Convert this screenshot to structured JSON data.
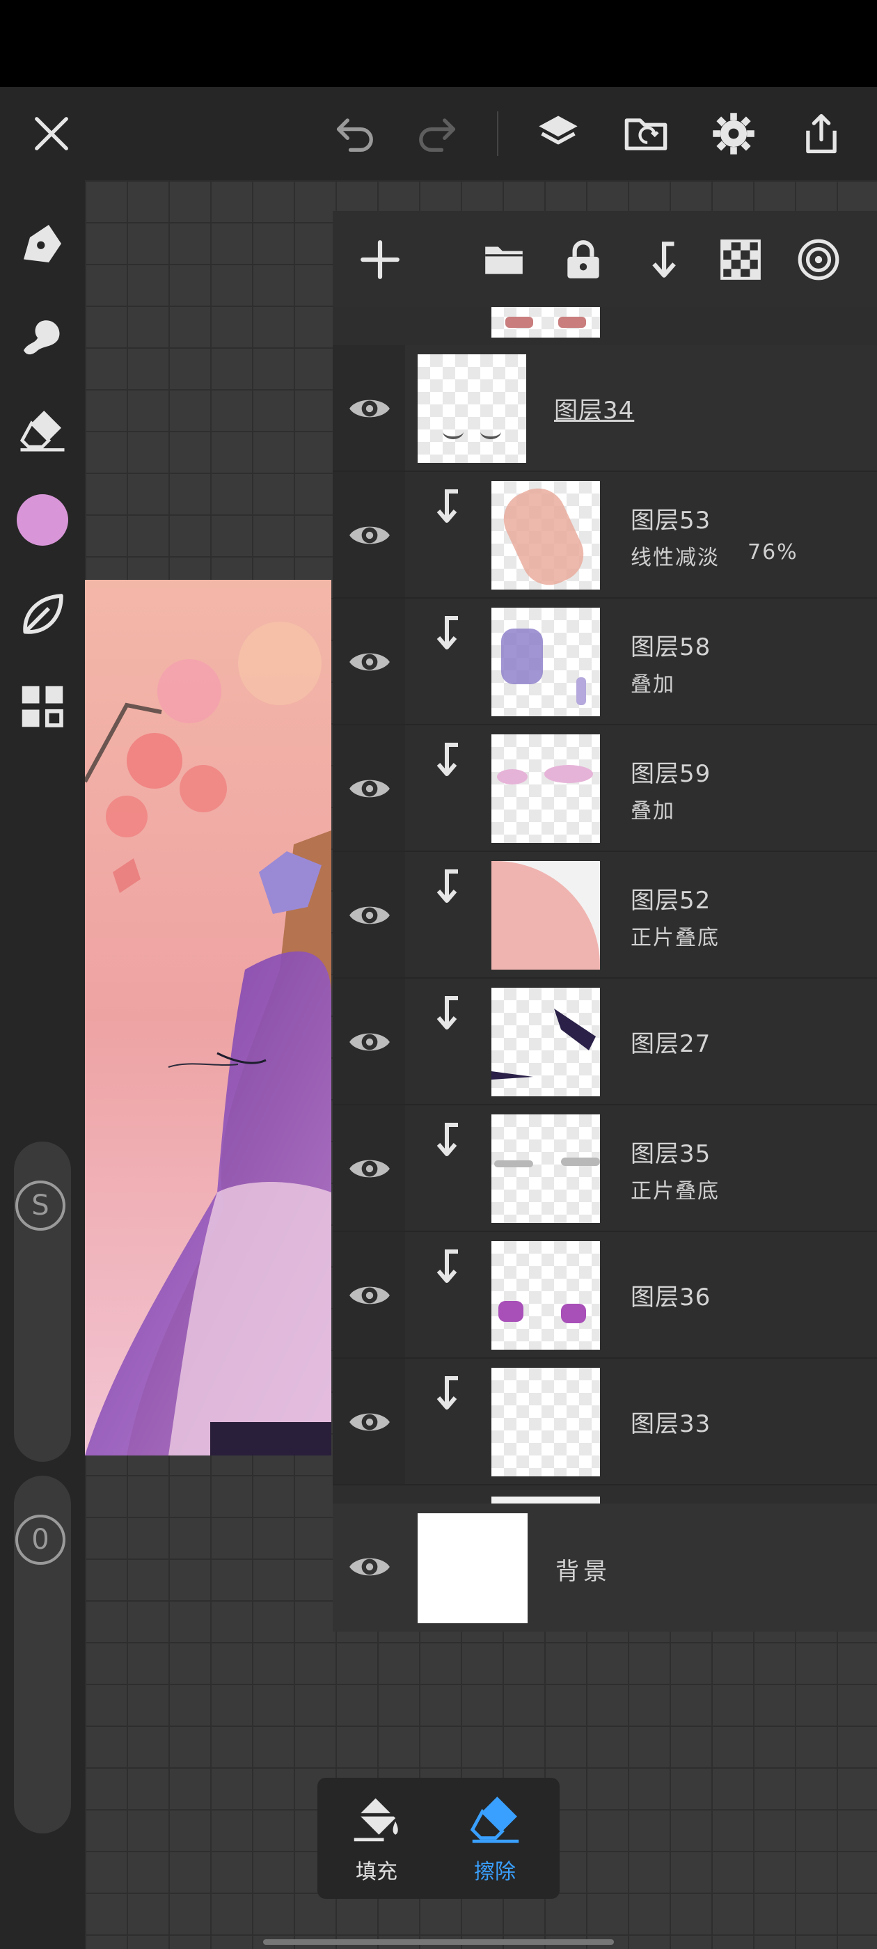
{
  "toolbar": {
    "close_icon": "close-icon",
    "undo_icon": "undo-icon",
    "redo_icon": "redo-icon",
    "layers_icon": "layers-icon",
    "import_icon": "folder-import-icon",
    "settings_icon": "gear-icon",
    "share_icon": "share-icon"
  },
  "left_tools": {
    "items": [
      "pen-icon",
      "smudge-icon",
      "eraser-icon",
      "color-swatch",
      "leaf-icon",
      "grid-icon"
    ],
    "current_color": "#d896d8",
    "size_label": "S",
    "opacity_label": "0"
  },
  "layers_panel": {
    "toolbar": [
      "add-layer-icon",
      "folder-icon",
      "lock-icon",
      "clip-icon",
      "checker-icon",
      "target-icon"
    ],
    "layers": [
      {
        "name": "图层34",
        "mode": "",
        "clipped": false,
        "selected": true
      },
      {
        "name": "图层53",
        "mode": "线性减淡",
        "opacity": "76%",
        "clipped": true
      },
      {
        "name": "图层58",
        "mode": "叠加",
        "clipped": true
      },
      {
        "name": "图层59",
        "mode": "叠加",
        "clipped": true
      },
      {
        "name": "图层52",
        "mode": "正片叠底",
        "clipped": true
      },
      {
        "name": "图层27",
        "mode": "",
        "clipped": true
      },
      {
        "name": "图层35",
        "mode": "正片叠底",
        "clipped": true
      },
      {
        "name": "图层36",
        "mode": "",
        "clipped": true
      },
      {
        "name": "图层33",
        "mode": "",
        "clipped": true
      }
    ],
    "background": {
      "name": "背景"
    }
  },
  "bottom_tools": {
    "fill_label": "填充",
    "erase_label": "擦除",
    "active_color": "#3aa0ff"
  }
}
